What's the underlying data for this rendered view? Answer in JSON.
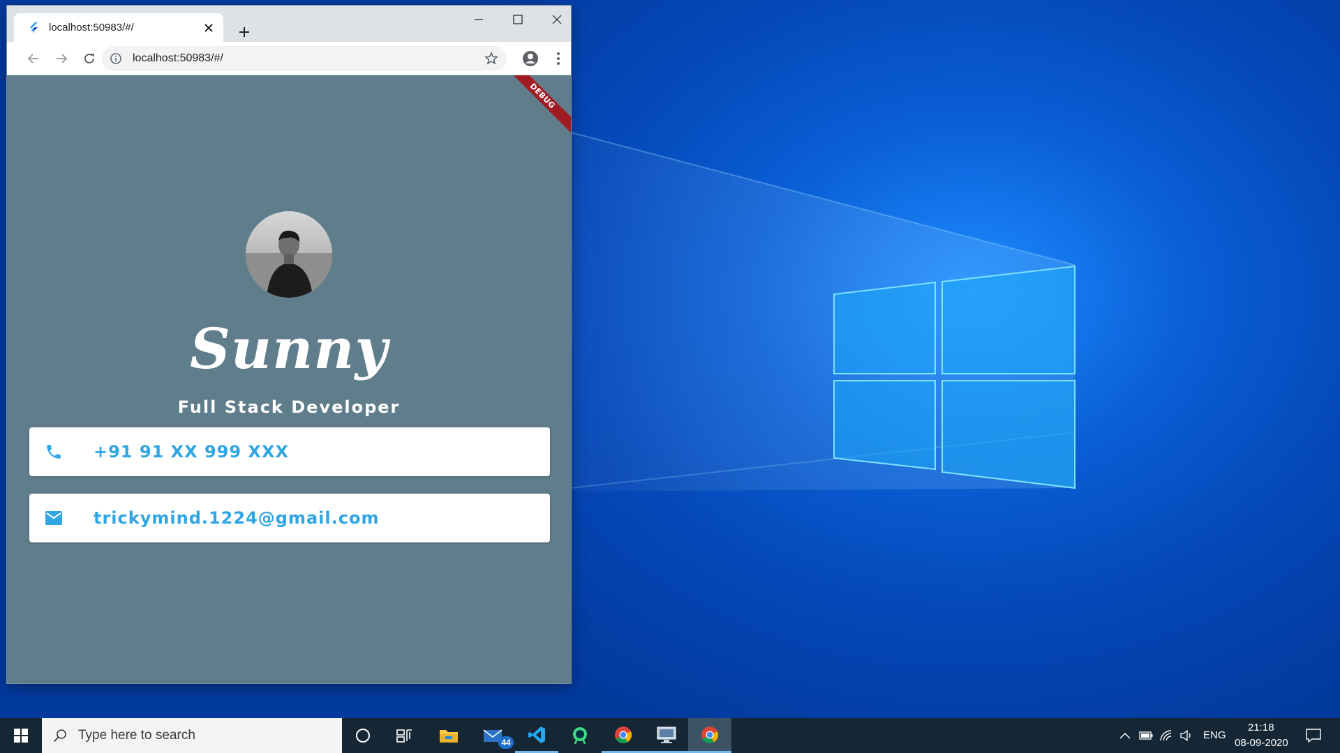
{
  "browser": {
    "tab_title": "localhost:50983/#/",
    "url": "localhost:50983/#/"
  },
  "app": {
    "debug_banner": "DEBUG",
    "name": "Sunny",
    "subtitle": "Full Stack Developer",
    "phone": "+91 91 XX 999 XXX",
    "email": "trickymind.1224@gmail.com",
    "background_color": "#607d8b",
    "accent_color": "#2fa5e3"
  },
  "taskbar": {
    "search_placeholder": "Type here to search",
    "mail_badge": "44",
    "language": "ENG",
    "time": "21:18",
    "date": "08-09-2020"
  },
  "icons": {
    "browser": [
      "flutter-icon",
      "close-icon",
      "plus-icon",
      "minimize-icon",
      "maximize-icon",
      "back-icon",
      "forward-icon",
      "reload-icon",
      "info-icon",
      "star-icon",
      "profile-icon",
      "menu-icon"
    ],
    "app": [
      "phone-icon",
      "mail-icon"
    ],
    "taskbar": [
      "windows-start-icon",
      "search-icon",
      "cortana-icon",
      "task-view-icon",
      "file-explorer-icon",
      "mail-icon",
      "vscode-icon",
      "android-studio-icon",
      "chrome-icon",
      "remote-desktop-icon",
      "chevron-up-icon",
      "battery-icon",
      "wifi-icon",
      "volume-icon",
      "notification-icon"
    ]
  }
}
